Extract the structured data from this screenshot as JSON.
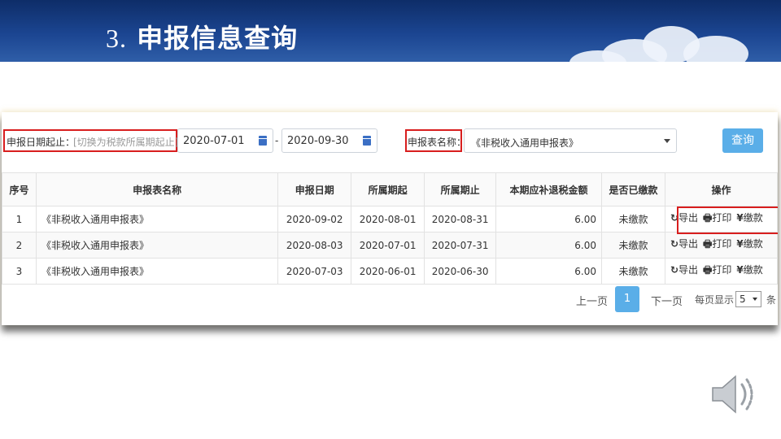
{
  "slide": {
    "number": "3.",
    "title": "申报信息查询"
  },
  "filters": {
    "date_label": "申报日期起止：",
    "date_switch": "[切换为税款所属期起止]",
    "date_from": "2020-07-01",
    "date_sep": "-",
    "date_to": "2020-09-30",
    "form_label": "申报表名称：",
    "form_value": "《非税收入通用申报表》",
    "query_button": "查询"
  },
  "table": {
    "columns": [
      "序号",
      "申报表名称",
      "申报日期",
      "所属期起",
      "所属期止",
      "本期应补退税金额",
      "是否已缴款",
      "操作"
    ],
    "rows": [
      [
        "1",
        "《非税收入通用申报表》",
        "2020-09-02",
        "2020-08-01",
        "2020-08-31",
        "6.00",
        "未缴款"
      ],
      [
        "2",
        "《非税收入通用申报表》",
        "2020-08-03",
        "2020-07-01",
        "2020-07-31",
        "6.00",
        "未缴款"
      ],
      [
        "3",
        "《非税收入通用申报表》",
        "2020-07-03",
        "2020-06-01",
        "2020-06-30",
        "6.00",
        "未缴款"
      ]
    ],
    "actions": {
      "export_icon": "↻",
      "export": "导出",
      "print_icon": "🖶",
      "print": "打印",
      "pay_icon": "¥",
      "pay": "缴款"
    }
  },
  "pager": {
    "prev": "上一页",
    "current": "1",
    "next": "下一页",
    "per_page_label": "每页显示",
    "per_page_value": "5",
    "suffix": "条"
  },
  "icons": {
    "speaker": "speaker-icon",
    "calendar": "calendar-icon"
  },
  "colors": {
    "banner": "#1b4591",
    "accent": "#5aaee8",
    "link": "#3f9be0",
    "highlight": "#d81e1e"
  }
}
